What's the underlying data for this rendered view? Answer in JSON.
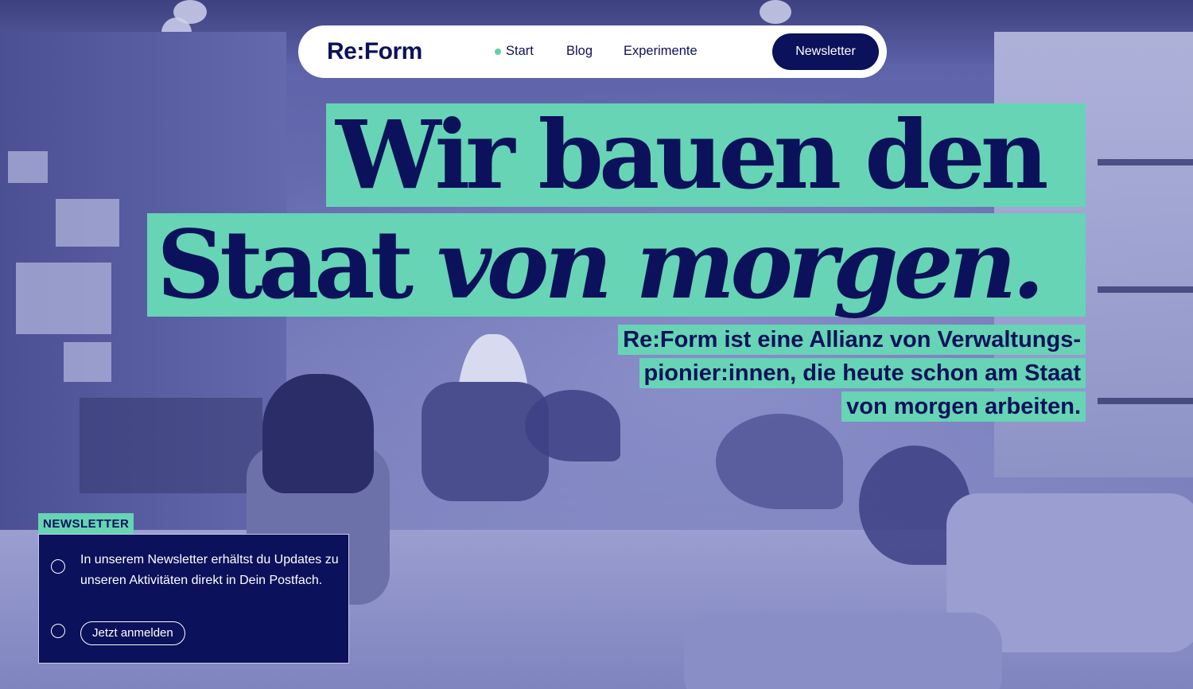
{
  "nav": {
    "logo": "Re:Form",
    "links": [
      {
        "label": "Start",
        "active": true
      },
      {
        "label": "Blog",
        "active": false
      },
      {
        "label": "Experimente",
        "active": false
      }
    ],
    "newsletter_button": "Newsletter"
  },
  "hero": {
    "headline_line1": "Wir bauen den",
    "headline_line2_regular": "Staat ",
    "headline_line2_italic": "von morgen.",
    "subline": [
      "Re:Form ist eine Allianz von Verwaltungs-",
      "pionier:innen, die heute schon am Staat",
      "von morgen arbeiten."
    ]
  },
  "newsletter_box": {
    "tag": "NEWSLETTER",
    "text": "In unserem Newsletter erhältst du Updates zu unseren Aktivitäten direkt in Dein Postfach.",
    "button": "Jetzt anmelden"
  },
  "colors": {
    "navy": "#0b115a",
    "mint": "#66d4b5",
    "photo_tint": "#6b70b3",
    "white": "#ffffff"
  }
}
